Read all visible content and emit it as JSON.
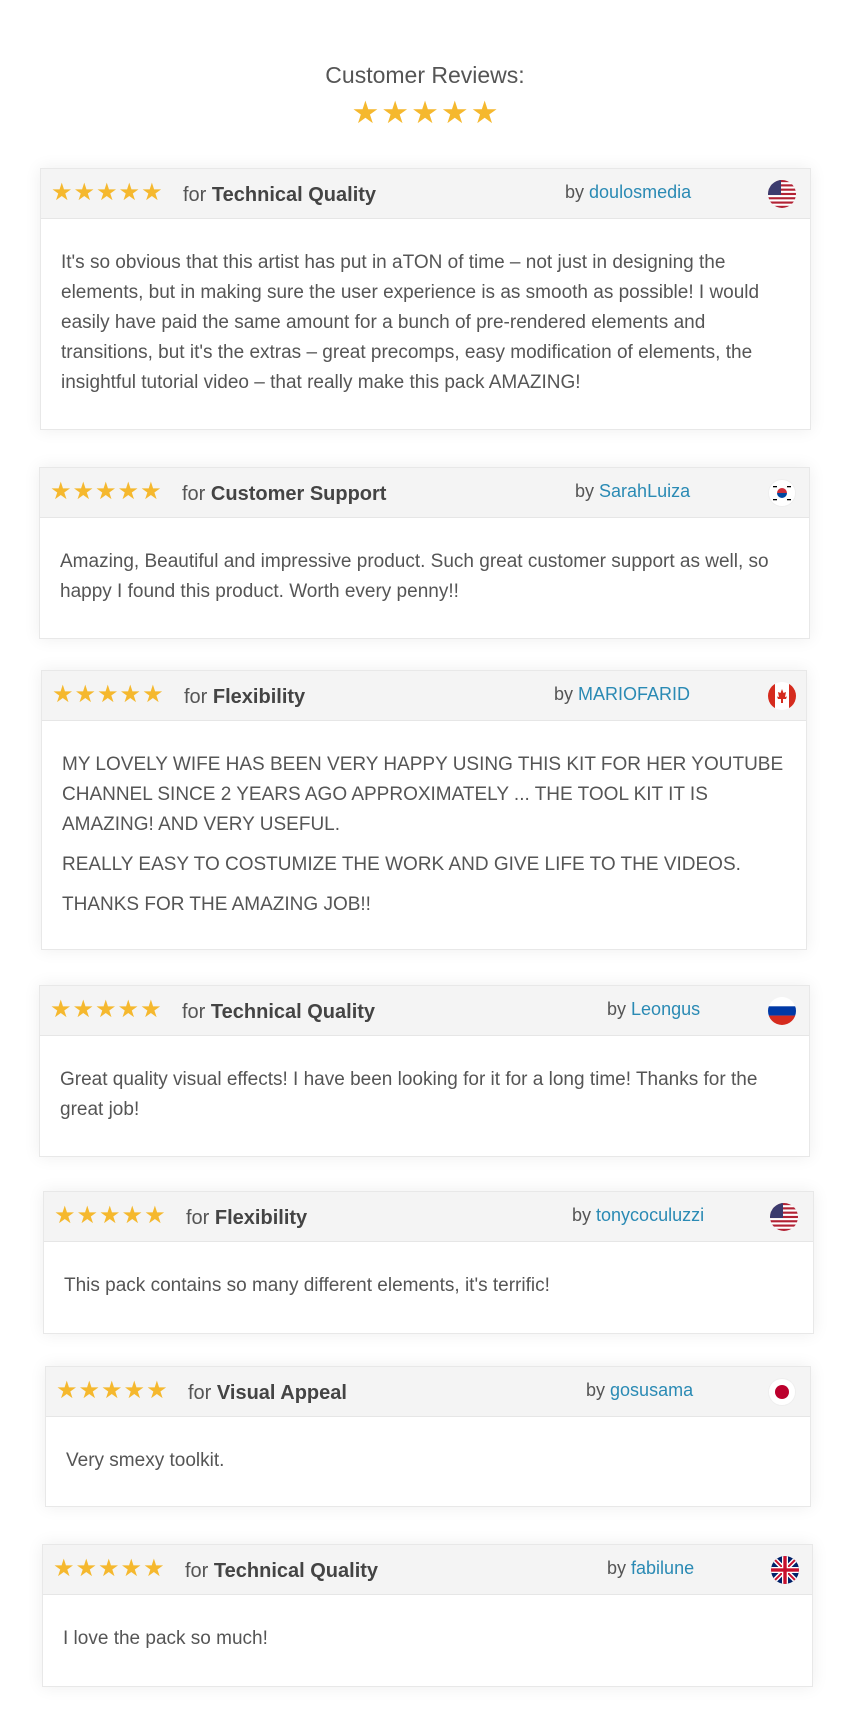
{
  "header": {
    "title": "Customer Reviews:",
    "rating_stars": 5
  },
  "colors": {
    "star": "#f5b82e",
    "link": "#2a8ab4",
    "card_header_bg": "#f4f4f4",
    "text": "#555555"
  },
  "reviews": [
    {
      "stars": 5,
      "for_prefix": "for",
      "category": "Technical Quality",
      "by_prefix": "by",
      "author": "doulosmedia",
      "flag": "us-flag-icon",
      "paragraphs": [
        "It's so obvious that this artist has put in aTON of time – not just in designing the elements, but in making sure the user experience is as smooth as possible! I would easily have paid the same amount for a bunch of pre-rendered elements and transitions, but it's the extras – great precomps, easy modification of elements, the insightful tutorial video – that really make this pack AMAZING!"
      ]
    },
    {
      "stars": 5,
      "for_prefix": "for",
      "category": "Customer Support",
      "by_prefix": "by",
      "author": "SarahLuiza",
      "flag": "kr-flag-icon",
      "paragraphs": [
        "Amazing, Beautiful and impressive product. Such great customer support as well, so happy I found this product. Worth every penny!!"
      ]
    },
    {
      "stars": 5,
      "for_prefix": "for",
      "category": "Flexibility",
      "by_prefix": "by",
      "author": "MARIOFARID",
      "flag": "ca-flag-icon",
      "paragraphs": [
        "MY LOVELY WIFE HAS BEEN VERY HAPPY USING THIS KIT FOR HER YOUTUBE CHANNEL SINCE 2 YEARS AGO APPROXIMATELY ... THE TOOL KIT IT IS AMAZING! AND VERY USEFUL.",
        "REALLY EASY TO COSTUMIZE THE WORK AND GIVE LIFE TO THE VIDEOS.",
        "THANKS FOR THE AMAZING JOB!!"
      ]
    },
    {
      "stars": 5,
      "for_prefix": "for",
      "category": "Technical Quality",
      "by_prefix": "by",
      "author": "Leongus",
      "flag": "ru-flag-icon",
      "paragraphs": [
        "Great quality visual effects! I have been looking for it for a long time! Thanks for the great job!"
      ]
    },
    {
      "stars": 5,
      "for_prefix": "for",
      "category": "Flexibility",
      "by_prefix": "by",
      "author": "tonycoculuzzi",
      "flag": "us-flag-icon",
      "paragraphs": [
        "This pack contains so many different elements, it's terrific!"
      ]
    },
    {
      "stars": 5,
      "for_prefix": "for",
      "category": "Visual Appeal",
      "by_prefix": "by",
      "author": "gosusama",
      "flag": "jp-flag-icon",
      "paragraphs": [
        "Very smexy toolkit."
      ]
    },
    {
      "stars": 5,
      "for_prefix": "for",
      "category": "Technical Quality",
      "by_prefix": "by",
      "author": "fabilune",
      "flag": "uk-flag-icon",
      "paragraphs": [
        "I love the pack so much!"
      ]
    }
  ]
}
